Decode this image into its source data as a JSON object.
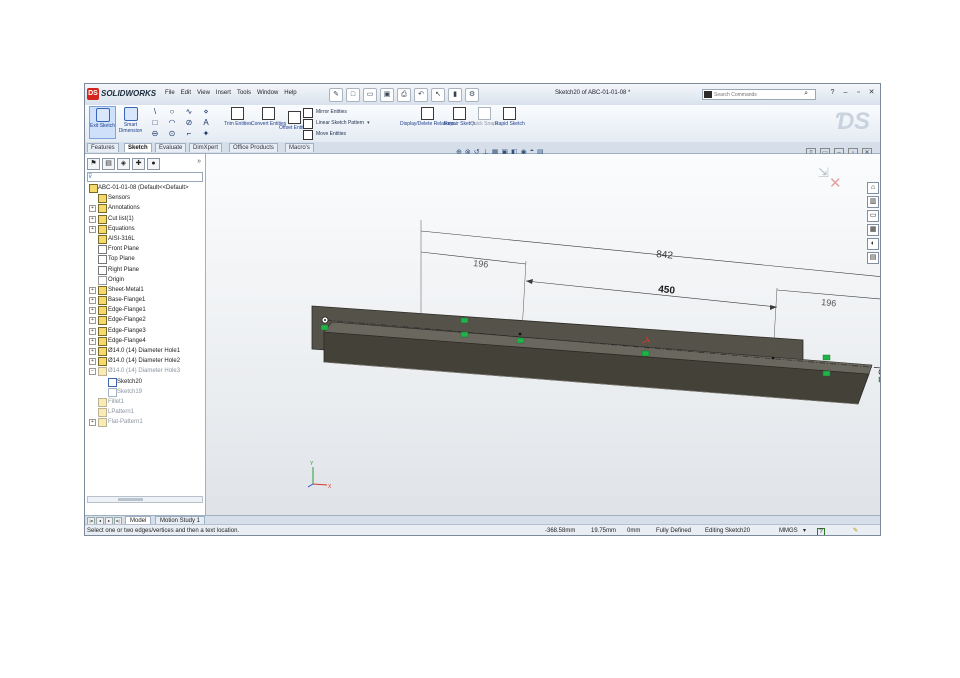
{
  "app": {
    "brand": "SOLIDWORKS",
    "brand_mark": "DS",
    "document_title": "Sketch20 of ABC-01-01-08 *",
    "menu": [
      "File",
      "Edit",
      "View",
      "Insert",
      "Tools",
      "Window",
      "Help"
    ],
    "search_placeholder": "Search Commands"
  },
  "command_manager": {
    "exit_sketch": "Exit Sketch",
    "smart_dimension": "Smart Dimension",
    "trim_entities": "Trim Entities",
    "convert_entities": "Convert Entities",
    "offset_entities": "Offset Entities",
    "mirror_entities": "Mirror Entities",
    "linear_sketch_pattern": "Linear Sketch Pattern",
    "move_entities": "Move Entities",
    "display_delete_relations": "Display/Delete Relations",
    "repair_sketch": "Repair Sketch",
    "quick_snaps": "Quick Snaps",
    "rapid_sketch": "Rapid Sketch"
  },
  "tabs": [
    {
      "label": "Features"
    },
    {
      "label": "Sketch"
    },
    {
      "label": "Evaluate"
    },
    {
      "label": "DimXpert"
    },
    {
      "label": "Office Products"
    },
    {
      "label": "Macro's"
    }
  ],
  "feature_tree": [
    {
      "label": "ABC-01-01-08  (Default<<Default>",
      "icon": "part-icon"
    },
    {
      "label": "Sensors",
      "icon": "sensor-icon"
    },
    {
      "label": "Annotations",
      "icon": "annotation-icon"
    },
    {
      "label": "Cut list(1)",
      "icon": "cutlist-icon"
    },
    {
      "label": "Equations",
      "icon": "equation-icon"
    },
    {
      "label": "AISI-316L",
      "icon": "material-icon"
    },
    {
      "label": "Front Plane",
      "icon": "plane-icon"
    },
    {
      "label": "Top Plane",
      "icon": "plane-icon"
    },
    {
      "label": "Right Plane",
      "icon": "plane-icon"
    },
    {
      "label": "Origin",
      "icon": "origin-icon"
    },
    {
      "label": "Sheet-Metal1",
      "icon": "sheetmetal-icon"
    },
    {
      "label": "Base-Flange1",
      "icon": "flange-icon"
    },
    {
      "label": "Edge-Flange1",
      "icon": "flange-icon"
    },
    {
      "label": "Edge-Flange2",
      "icon": "flange-icon"
    },
    {
      "label": "Edge-Flange3",
      "icon": "flange-icon"
    },
    {
      "label": "Edge-Flange4",
      "icon": "flange-icon"
    },
    {
      "label": "Ø14.0 (14) Diameter Hole1",
      "icon": "hole-icon"
    },
    {
      "label": "Ø14.0 (14) Diameter Hole2",
      "icon": "hole-icon"
    },
    {
      "label": "Ø14.0 (14) Diameter Hole3",
      "icon": "hole-icon"
    },
    {
      "label": "Sketch20",
      "icon": "sketch-icon"
    },
    {
      "label": "Sketch19",
      "icon": "sketch-icon"
    },
    {
      "label": "Fillet1",
      "icon": "fillet-icon"
    },
    {
      "label": "LPattern1",
      "icon": "pattern-icon"
    },
    {
      "label": "Flat-Pattern1",
      "icon": "flatpattern-icon"
    }
  ],
  "dimensions": {
    "overall": "842",
    "left": "196",
    "middle": "450",
    "right": "196"
  },
  "bottom_tabs": [
    "Model",
    "Motion Study 1"
  ],
  "status": {
    "prompt": "Select one or two edges/vertices and then a text location.",
    "x": "-368.58mm",
    "y": "19.75mm",
    "z": "0mm",
    "state": "Fully Defined",
    "editing": "Editing Sketch20",
    "units": "MMGS",
    "units_caret": "▾"
  },
  "colors": {
    "part": "#4b4840",
    "part_top": "#57544c",
    "dimension": "#3a3a3a",
    "relation": "#1fb34a",
    "axis_x": "#d23a2f",
    "axis_y": "#2d9d3b",
    "axis_z": "#2a4fc8"
  }
}
